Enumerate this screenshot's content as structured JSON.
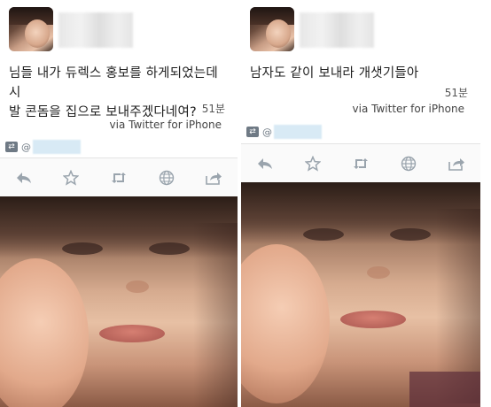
{
  "tweets": [
    {
      "text_line1": "님들 내가 듀렉스 홍보를 하게되었는데 시",
      "text_line2": "발 콘돔을 집으로 보내주겠다네여?",
      "time": "51분",
      "via": "via Twitter for iPhone",
      "retweet_at": "@"
    },
    {
      "text_line1": "남자도 같이 보내라 개샛기들아",
      "text_line2": "",
      "time": "51분",
      "via": "via Twitter for iPhone",
      "retweet_at": "@"
    }
  ],
  "actions": [
    {
      "icon": "reply-icon"
    },
    {
      "icon": "star-icon"
    },
    {
      "icon": "retweet-icon"
    },
    {
      "icon": "globe-icon"
    },
    {
      "icon": "share-icon"
    }
  ],
  "colors": {
    "icon": "#9aa4ad",
    "text": "#1f1f1f",
    "divider": "#e3e3e3"
  }
}
